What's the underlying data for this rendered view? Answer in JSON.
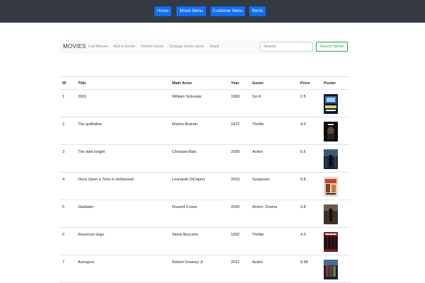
{
  "topnav": {
    "buttons": [
      {
        "label": "Home"
      },
      {
        "label": "Movie Menu"
      },
      {
        "label": "Customer Menu"
      },
      {
        "label": "Rents"
      }
    ]
  },
  "subnav": {
    "brand": "MOVIES",
    "links": [
      "List Movies",
      "Add a movie",
      "Delete movie",
      "Change movie price",
      "Back"
    ],
    "search_placeholder": "Search",
    "search_button": "Search Movie"
  },
  "table": {
    "headers": [
      "ID",
      "Title",
      "Main Actor",
      "Year",
      "Genre",
      "Price",
      "Poster"
    ],
    "rows": [
      {
        "id": "1",
        "title": "2001",
        "actor": "William Sylvester",
        "year": "1968",
        "genre": "Sci-fi",
        "price": "2.5"
      },
      {
        "id": "2",
        "title": "The godfather",
        "actor": "Marlon Brando",
        "year": "1972",
        "genre": "Thriller",
        "price": "4.0"
      },
      {
        "id": "3",
        "title": "The dark knight",
        "actor": "Christian Bale",
        "year": "2008",
        "genre": "Action",
        "price": "5.5"
      },
      {
        "id": "4",
        "title": "Once Upon a Time in Hollywood",
        "actor": "Leonardo DiCaprio",
        "year": "2019",
        "genre": "Suspense",
        "price": "9.8"
      },
      {
        "id": "5",
        "title": "Gladiator",
        "actor": "Russell Crowe",
        "year": "2000",
        "genre": "Action- Drama",
        "price": "3.8"
      },
      {
        "id": "6",
        "title": "Reservoir dogs",
        "actor": "Steve Buscemi",
        "year": "1992",
        "genre": "Thriller",
        "price": "4.0"
      },
      {
        "id": "7",
        "title": "Avengers",
        "actor": "Robert Downey Jr",
        "year": "2012",
        "genre": "Action",
        "price": "9.99"
      }
    ]
  },
  "colors": {
    "topbar": "#343a40",
    "primary": "#0d6efd",
    "success": "#28a745"
  }
}
